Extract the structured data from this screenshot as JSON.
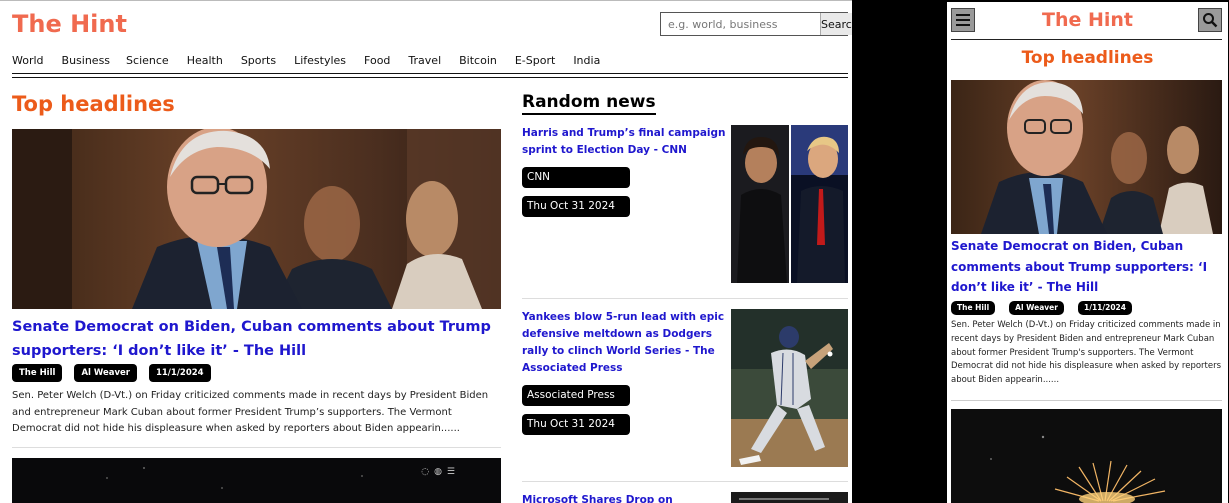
{
  "desktop": {
    "logo": "The Hint",
    "search": {
      "placeholder": "e.g. world, business",
      "button_label": "Search"
    },
    "nav": [
      "World",
      "Business",
      "Science",
      "Health",
      "Sports",
      "Lifestyles",
      "Food",
      "Travel",
      "Bitcoin",
      "E-Sport",
      "India"
    ],
    "top_headlines": {
      "heading": "Top headlines",
      "featured": {
        "title": "Senate Democrat on Biden, Cuban comments about Trump supporters: ‘I don’t like it’ - The Hill",
        "source": "The Hill",
        "author": "Al Weaver",
        "date": "11/1/2024",
        "description": "Sen. Peter Welch (D-Vt.) on Friday criticized comments made in recent days by President Biden and entrepreneur Mark Cuban about former President Trump’s supporters. The Vermont Democrat did not hide his displeasure when asked by reporters about Biden appearin......"
      }
    },
    "random_news": {
      "heading": "Random news",
      "items": [
        {
          "title": "Harris and Trump’s final campaign sprint to Election Day - CNN",
          "source": "CNN",
          "date": "Thu Oct 31 2024"
        },
        {
          "title": "Yankees blow 5-run lead with epic defensive meltdown as Dodgers rally to clinch World Series - The Associated Press",
          "source": "Associated Press",
          "date": "Thu Oct 31 2024"
        },
        {
          "title": "Microsoft Shares Drop on"
        }
      ]
    }
  },
  "mobile": {
    "logo": "The Hint",
    "heading": "Top headlines",
    "featured": {
      "title": "Senate Democrat on Biden, Cuban comments about Trump supporters: ‘I don’t like it’ - The Hill",
      "source": "The Hill",
      "author": "Al Weaver",
      "date": "1/11/2024",
      "description": "Sen. Peter Welch (D-Vt.) on Friday criticized comments made in recent days by President Biden and entrepreneur Mark Cuban about former President Trump's supporters. The Vermont Democrat did not hide his displeasure when asked by reporters about Biden appearin......"
    }
  },
  "colors": {
    "logo": "#f06a4f",
    "heading": "#ec5b1a",
    "link": "#1f17ce",
    "pill": "#000000"
  }
}
